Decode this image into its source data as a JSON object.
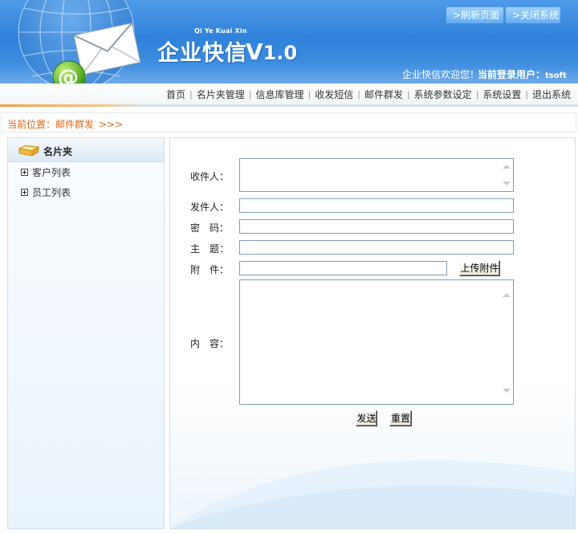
{
  "header": {
    "brand_pinyin": "Qi Ye Kuai Xin",
    "brand_title": "企业快信",
    "brand_version_v": "V",
    "brand_version_num": "1.0",
    "refresh_label": ">刷新页面",
    "close_label": ">关闭系统",
    "welcome": "企业快信欢迎您！",
    "user_label": "当前登录用户：",
    "user_name": "tsoft"
  },
  "nav": {
    "items": [
      "首页",
      "名片夹管理",
      "信息库管理",
      "收发短信",
      "邮件群发",
      "系统参数设定",
      "系统设置",
      "退出系统"
    ]
  },
  "breadcrumb": {
    "text": "当前位置：邮件群发",
    "arrows": ">>>"
  },
  "sidebar": {
    "title": "名片夹",
    "items": [
      "客户列表",
      "员工列表"
    ]
  },
  "form": {
    "recipient_label": "收件人：",
    "recipient_value": "",
    "sender_label": "发件人：",
    "sender_value": "",
    "password_label": "密　码：",
    "password_value": "",
    "subject_label": "主　题：",
    "subject_value": "",
    "attachment_label": "附　件：",
    "attachment_value": "",
    "upload_label": "上传附件",
    "content_label": "内　容：",
    "content_value": "",
    "send_label": "发送",
    "reset_label": "重置"
  },
  "colors": {
    "header_blue": "#2f82db",
    "breadcrumb_orange": "#e2640f",
    "border_blue": "#cfe0ef"
  }
}
